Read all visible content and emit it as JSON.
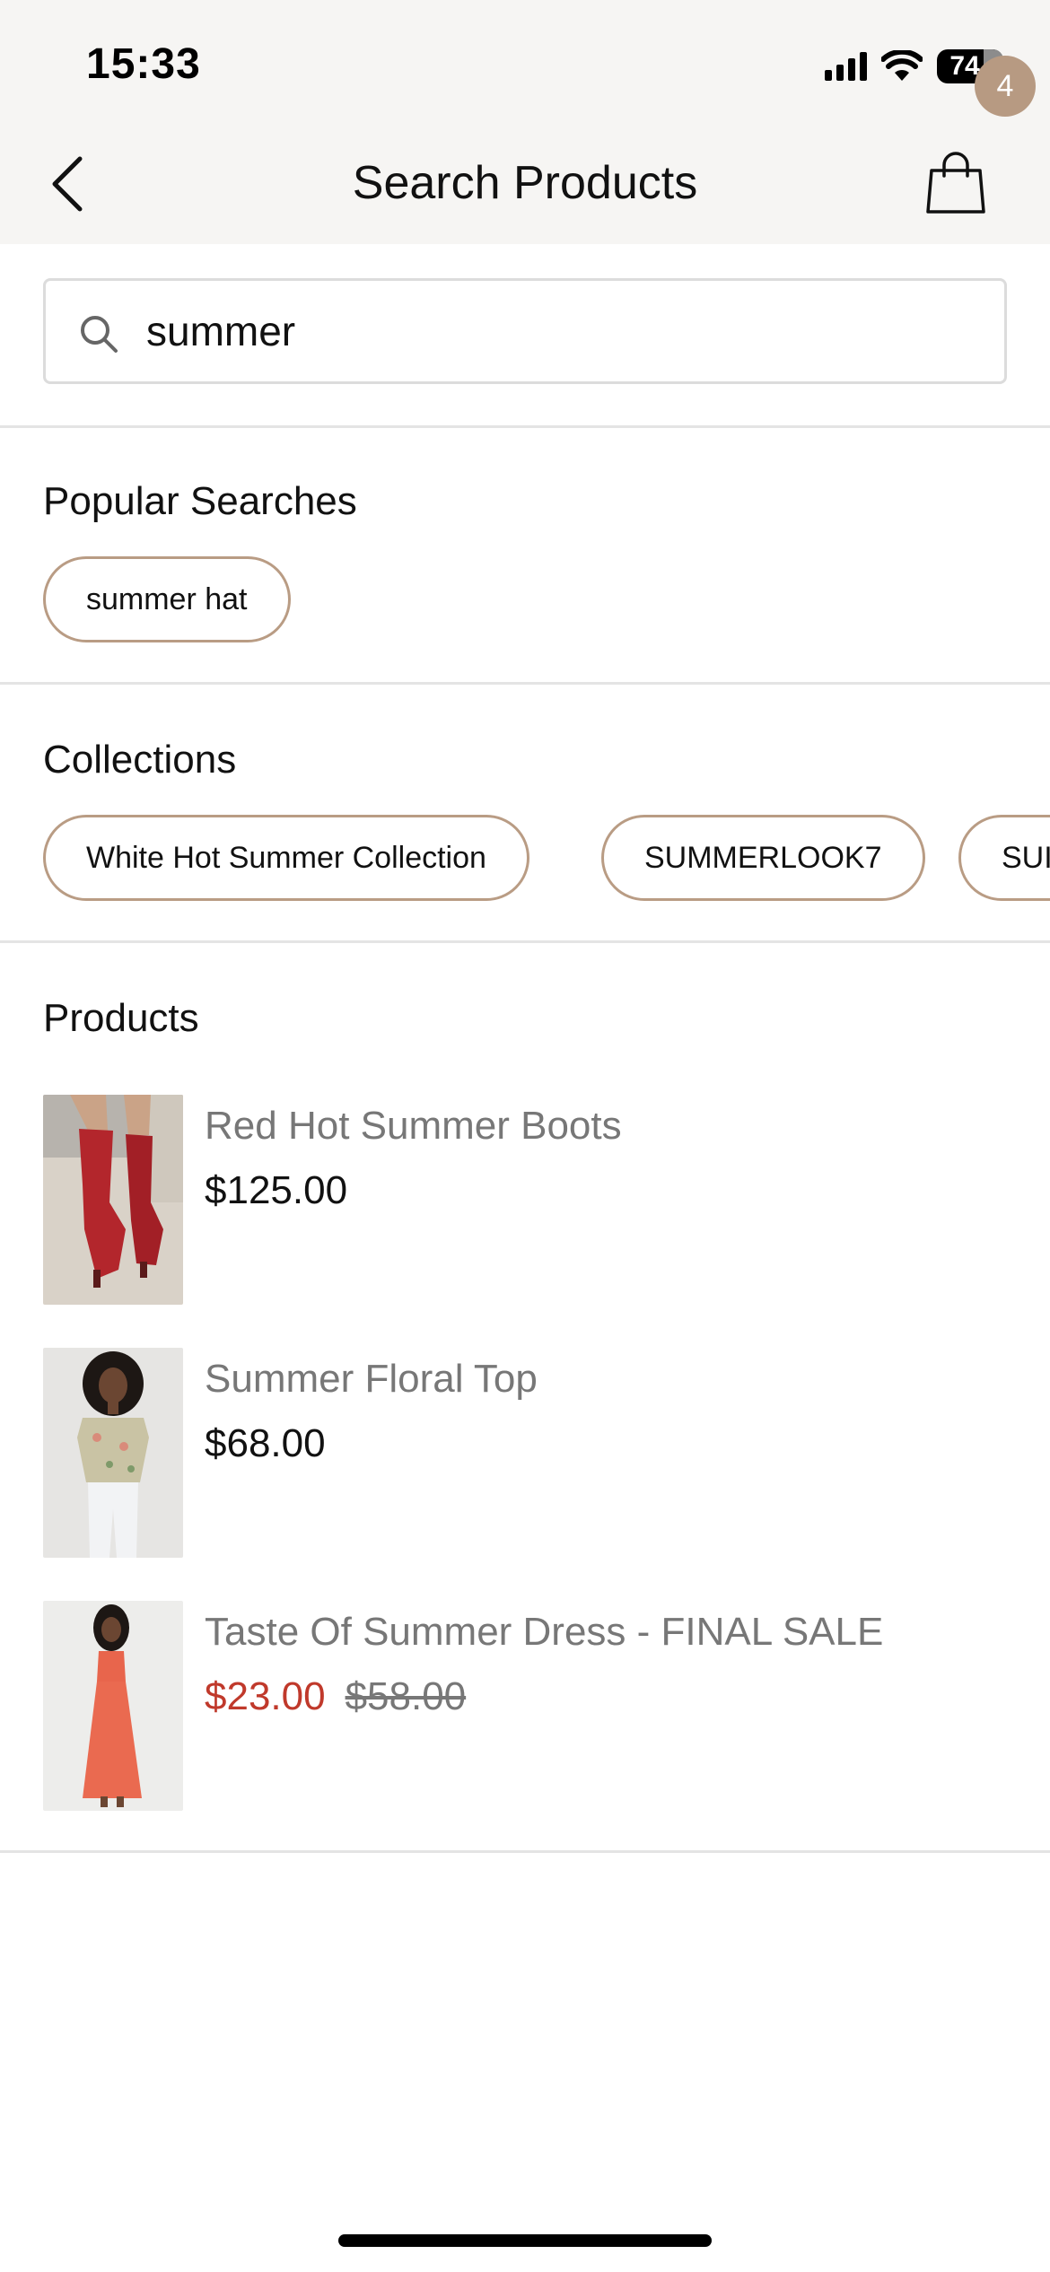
{
  "status_bar": {
    "time": "15:33",
    "battery": "74",
    "icons": [
      "signal-icon",
      "wifi-icon",
      "battery-icon"
    ]
  },
  "header": {
    "title": "Search Products",
    "back_icon": "chevron-left-icon",
    "cart_icon": "shopping-bag-icon",
    "cart_count": "4"
  },
  "search": {
    "value": "summer",
    "icon": "search-icon"
  },
  "popular": {
    "title": "Popular Searches",
    "items": [
      {
        "label": "summer hat"
      }
    ]
  },
  "collections": {
    "title": "Collections",
    "items": [
      {
        "label": "White Hot Summer Collection"
      },
      {
        "label": "SUMMERLOOK7"
      },
      {
        "label": "SUI"
      }
    ]
  },
  "products": {
    "title": "Products",
    "items": [
      {
        "name": "Red Hot Summer Boots",
        "price": "$125.00"
      },
      {
        "name": "Summer Floral Top",
        "price": "$68.00"
      },
      {
        "name": "Taste Of Summer Dress - FINAL SALE",
        "sale_price": "$23.00",
        "original_price": "$58.00"
      }
    ]
  },
  "colors": {
    "accent": "#b99c84",
    "badge": "#b79a82",
    "sale": "#c0392b",
    "header_bg": "#f6f5f3"
  }
}
